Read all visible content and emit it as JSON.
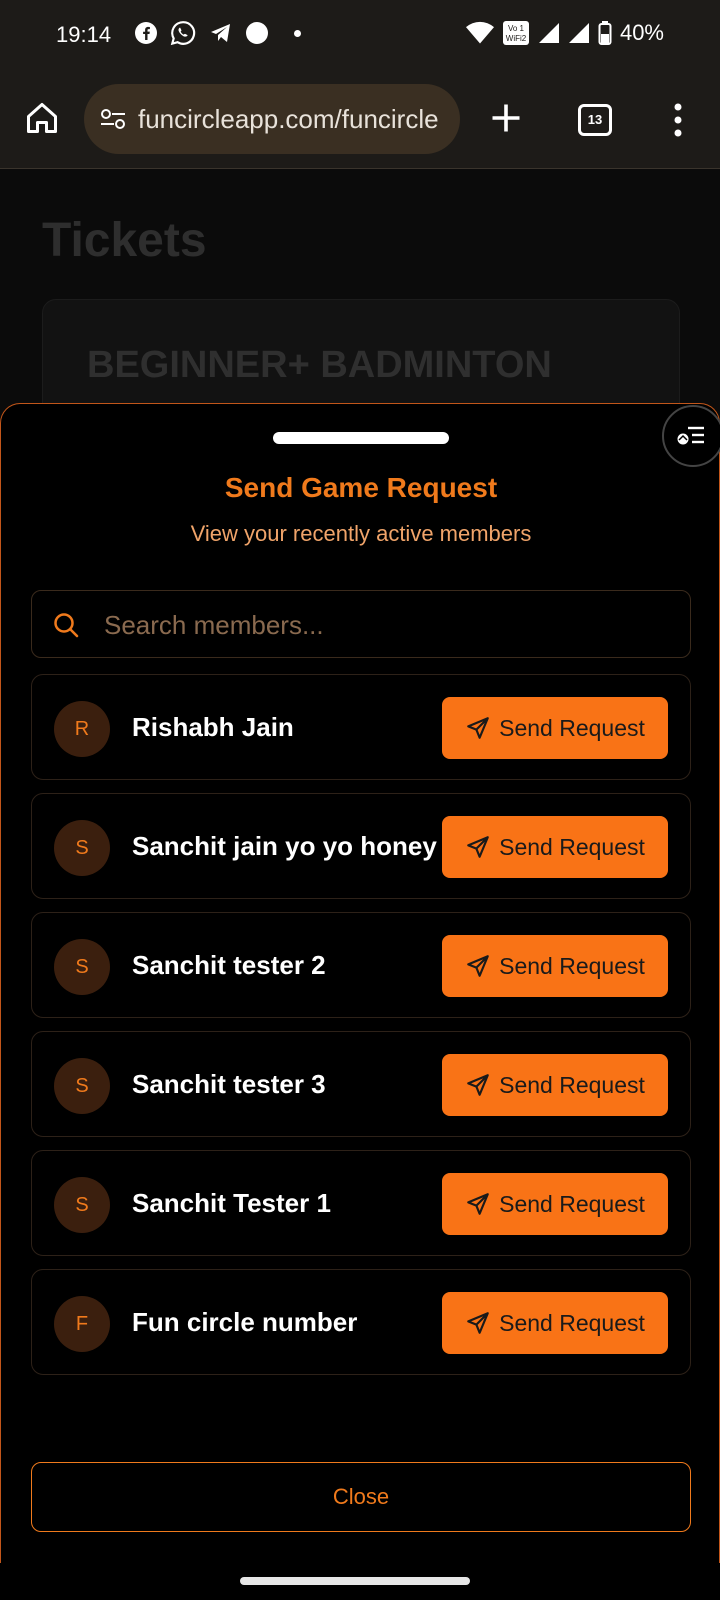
{
  "status_bar": {
    "time": "19:14",
    "battery": "40%",
    "icons": [
      "facebook-icon",
      "whatsapp-icon",
      "telegram-icon",
      "circle-icon",
      "dot-icon",
      "wifi-icon",
      "volte-icon",
      "signal-icon",
      "signal-icon",
      "battery-icon"
    ]
  },
  "browser": {
    "url": "funcircleapp.com/funcircle",
    "tab_count": "13"
  },
  "background_page": {
    "title": "Tickets",
    "card_title": "BEGINNER+ BADMINTON"
  },
  "sheet": {
    "title": "Send Game Request",
    "subtitle": "View your recently active members",
    "search_placeholder": "Search members...",
    "send_label": "Send Request",
    "close_label": "Close",
    "members": [
      {
        "initial": "R",
        "name": "Rishabh Jain"
      },
      {
        "initial": "S",
        "name": "Sanchit jain yo yo honey"
      },
      {
        "initial": "S",
        "name": "Sanchit tester 2"
      },
      {
        "initial": "S",
        "name": "Sanchit tester 3"
      },
      {
        "initial": "S",
        "name": "Sanchit Tester 1"
      },
      {
        "initial": "F",
        "name": "Fun circle number"
      }
    ]
  },
  "colors": {
    "accent": "#f97316",
    "accent_text": "#f07a1c",
    "avatar_bg": "#3b1f0e"
  }
}
